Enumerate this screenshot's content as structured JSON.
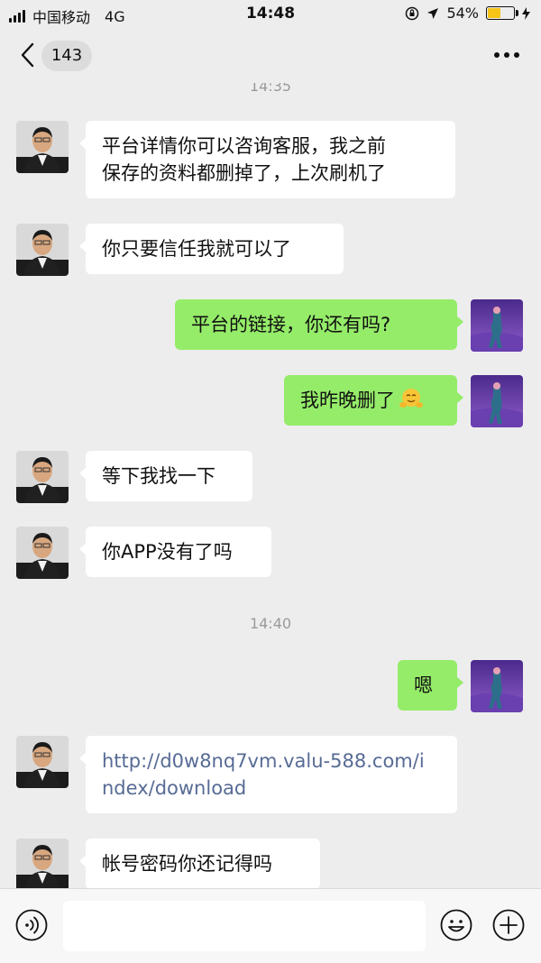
{
  "status_bar": {
    "carrier": "中国移动",
    "network": "4G",
    "time": "14:48",
    "battery_percent": "54%",
    "battery_level": 0.54
  },
  "header": {
    "unread_count": "143"
  },
  "chat": {
    "timestamps": [
      "14:35",
      "14:40"
    ],
    "messages": [
      {
        "side": "left",
        "text": "平台详情你可以咨询客服，我之前\n保存的资料都删掉了，上次刷机了"
      },
      {
        "side": "left",
        "text": "你只要信任我就可以了"
      },
      {
        "side": "right",
        "text": "平台的链接，你还有吗?"
      },
      {
        "side": "right",
        "text": "我昨晚删了",
        "emoji": "awkward-smile-emoji"
      },
      {
        "side": "left",
        "text": "等下我找一下"
      },
      {
        "side": "left",
        "text": "你APP没有了吗"
      },
      {
        "side": "right",
        "text": "嗯"
      },
      {
        "side": "left",
        "text": "http://d0w8nq7vm.valu-588.com/i\nndex/download",
        "is_link": true
      },
      {
        "side": "left",
        "text": "帐号密码你还记得吗"
      }
    ]
  },
  "input_bar": {
    "message_value": "",
    "icons": [
      "voice-icon",
      "emoji-icon",
      "plus-icon"
    ]
  },
  "colors": {
    "background": "#ededed",
    "sent_bubble": "#95ec69",
    "received_bubble": "#ffffff",
    "link": "#576b95",
    "battery": "#f5c518"
  }
}
